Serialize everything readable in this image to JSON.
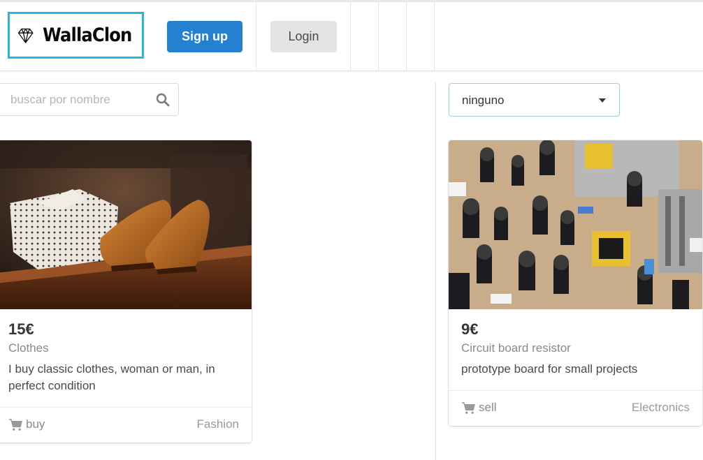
{
  "navbar": {
    "brand": "WallaClon",
    "signup_label": "Sign up",
    "login_label": "Login"
  },
  "filters": {
    "search_placeholder": "buscar por nombre",
    "search_value": "",
    "tag_selected": "ninguno"
  },
  "ads": [
    {
      "price": "15€",
      "name": "Clothes",
      "description": "I buy classic clothes, woman or man, in perfect condition",
      "type": "buy",
      "tag": "Fashion"
    },
    {
      "price": "9€",
      "name": "Circuit board resistor",
      "description": "prototype board for small projects",
      "type": "sell",
      "tag": "Electronics"
    }
  ],
  "colors": {
    "brand_border": "#29b6e6",
    "signup_bg": "#2481d1",
    "login_bg": "#e4e4e4"
  },
  "icons": {
    "brand": "diamond-icon",
    "search": "search-icon",
    "cart": "cart-icon",
    "select": "caret-down-icon"
  }
}
